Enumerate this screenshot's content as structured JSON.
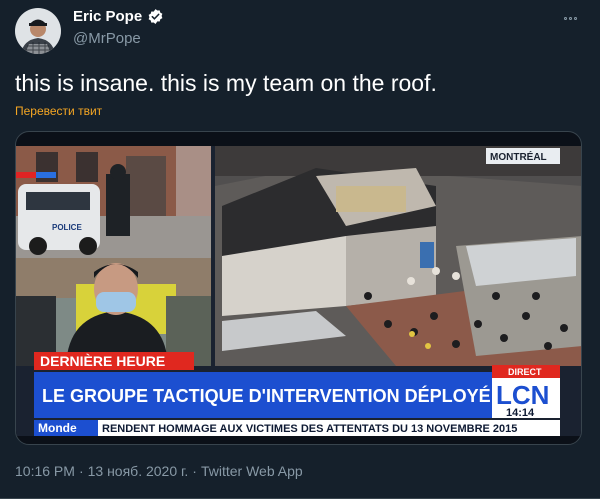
{
  "author": {
    "name": "Eric Pope",
    "handle": "@MrPope"
  },
  "tweet": {
    "text": "this is insane. this is my team on the roof.",
    "translate_label": "Перевести твит"
  },
  "media": {
    "location_tag": "MONTRÉAL",
    "breaking_label": "DERNIÈRE HEURE",
    "headline": "LE GROUPE TACTIQUE D'INTERVENTION DÉPLOYÉ",
    "live_label": "DIRECT",
    "channel": "LCN",
    "clock": "14:14",
    "ticker_section": "Monde",
    "ticker_text": "RENDENT HOMMAGE AUX VICTIMES DES ATTENTATS DU 13 NOVEMBRE 2015",
    "police_text": "POLICE"
  },
  "meta": {
    "time": "10:16 PM",
    "sep1": "·",
    "date": "13 нояб. 2020 г.",
    "sep2": "·",
    "app": "Twitter Web App"
  },
  "colors": {
    "background": "#15202b",
    "muted": "#8899a6",
    "translate": "#f5a623",
    "verified": "#ffffff",
    "tv_blue": "#1c4fd0",
    "tv_red": "#e0281f"
  }
}
